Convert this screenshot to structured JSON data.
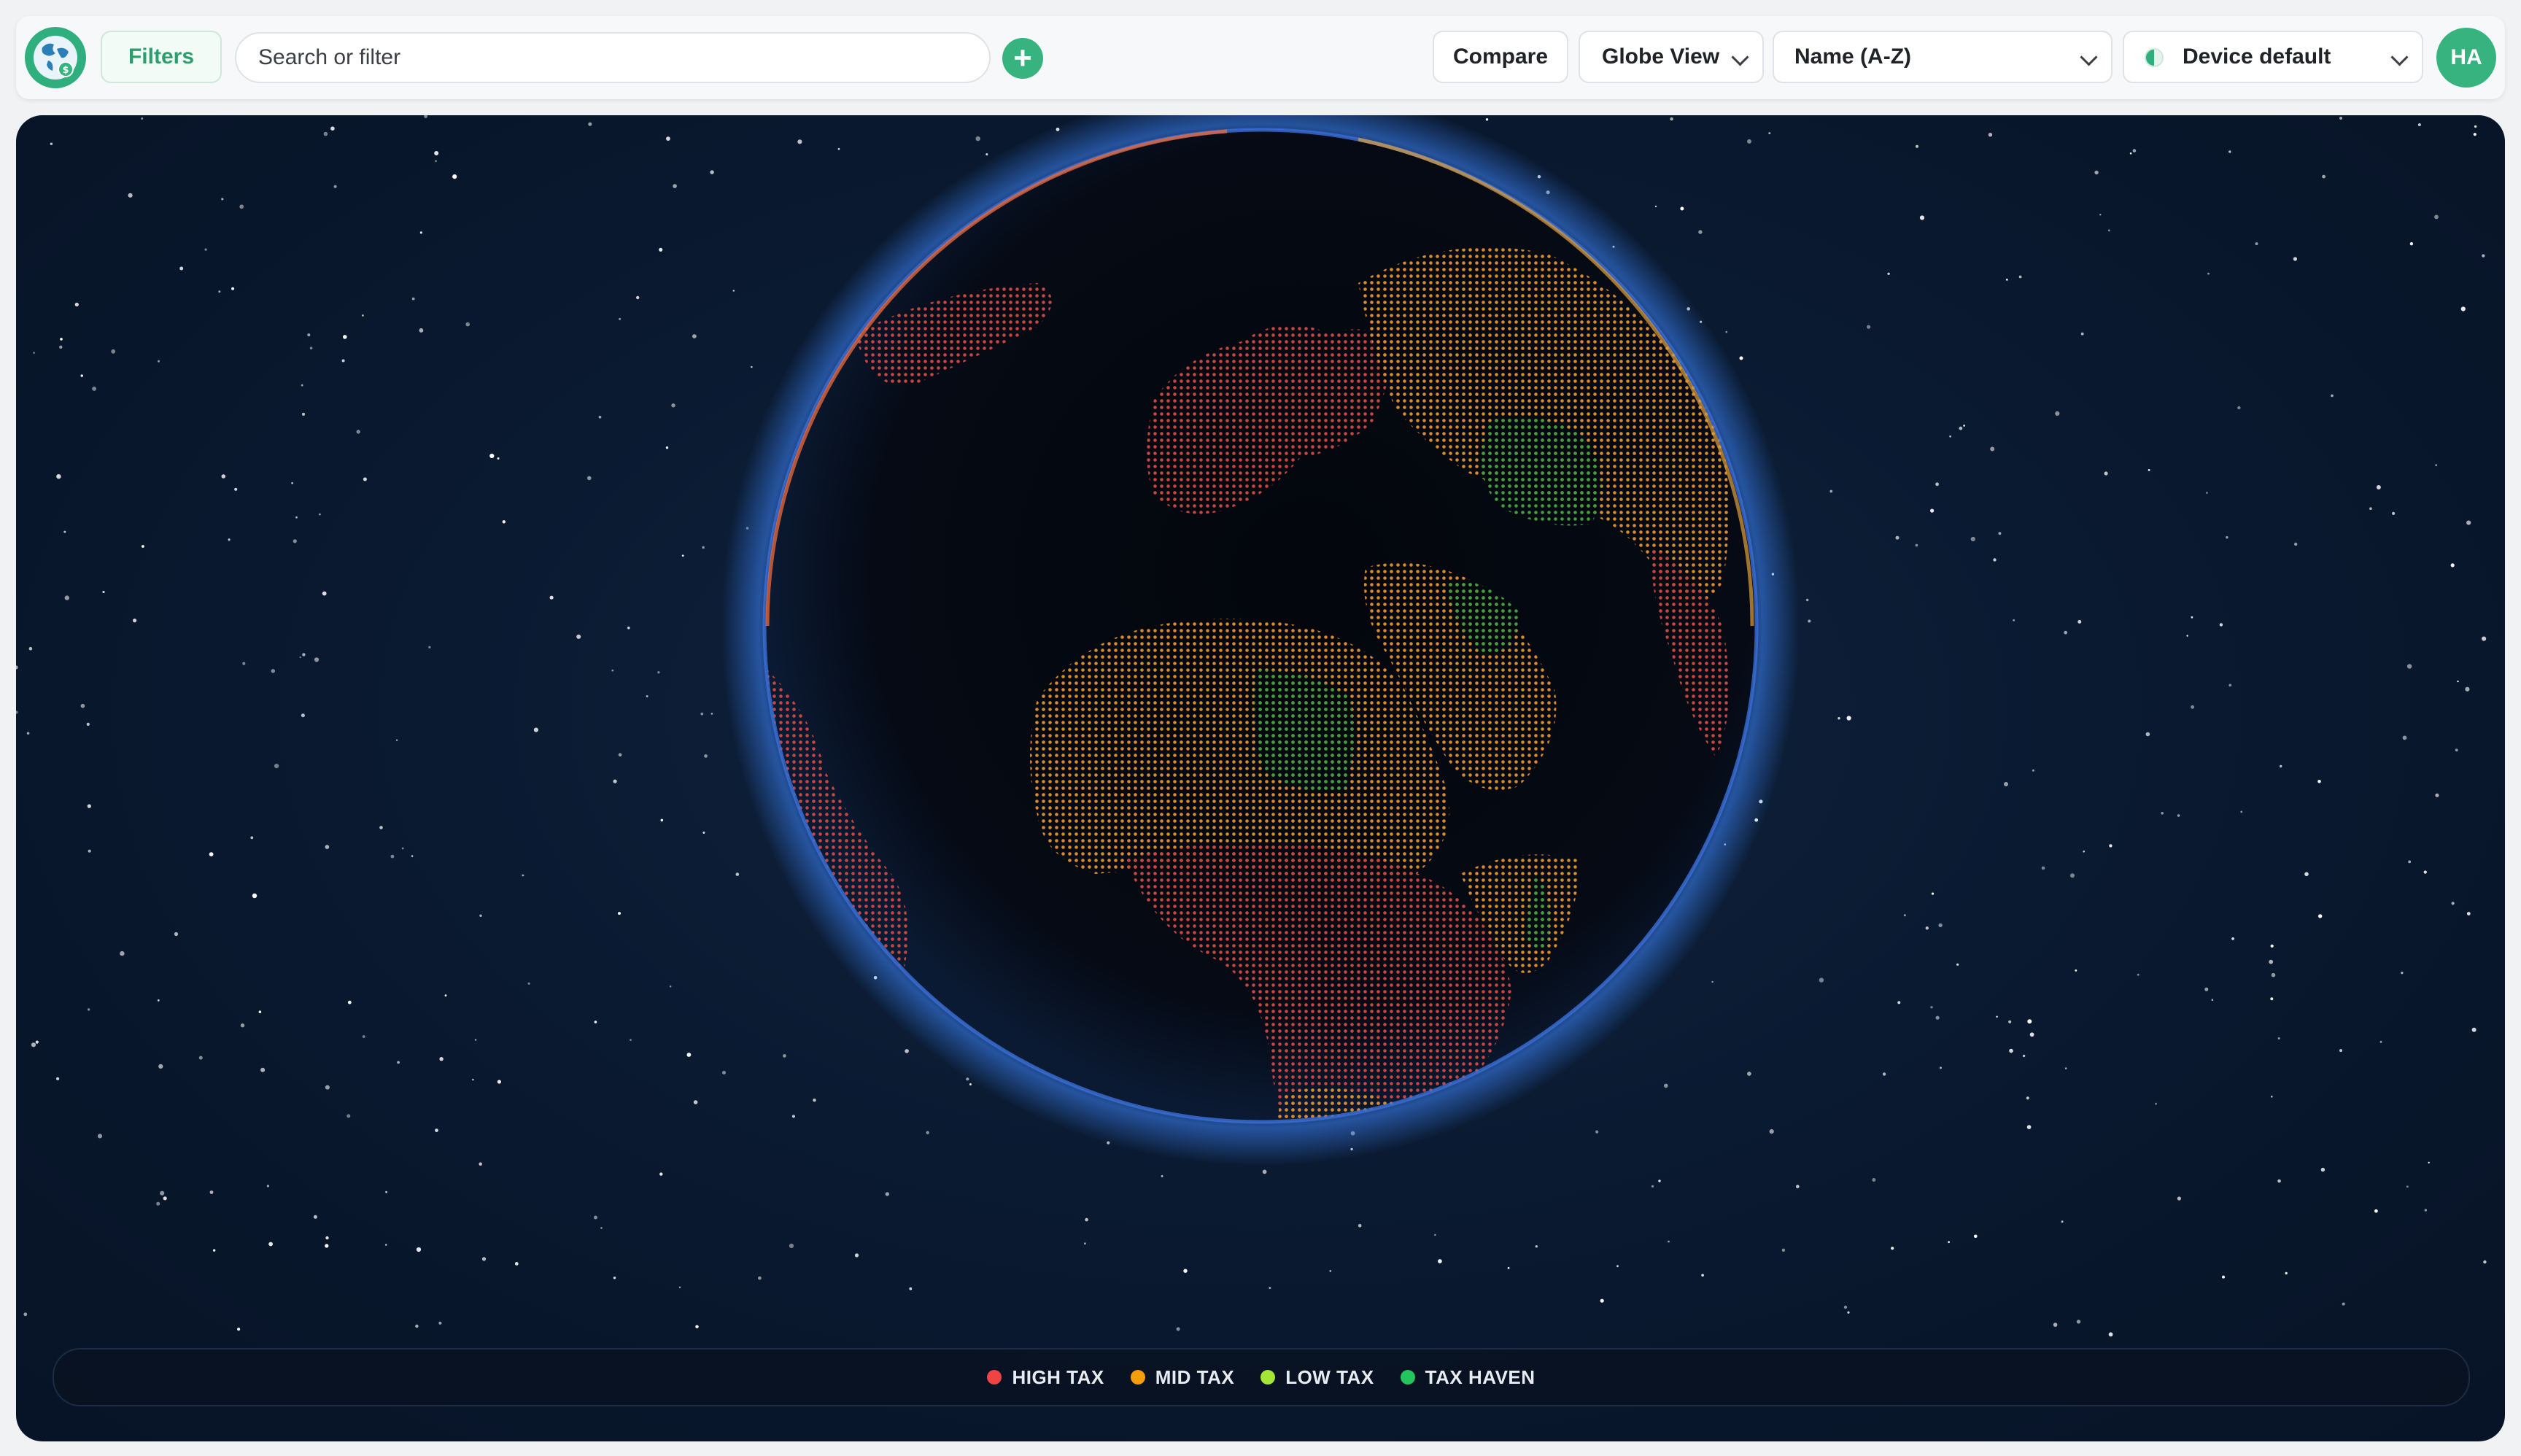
{
  "toolbar": {
    "filters_label": "Filters",
    "search_placeholder": "Search or filter",
    "add_symbol": "+",
    "compare_label": "Compare",
    "view_label": "Globe View",
    "sort_label": "Name (A-Z)",
    "theme_label": "Device default",
    "avatar_initials": "HA"
  },
  "icons": {
    "logo": "globe-logo-icon",
    "add": "plus-icon",
    "chevron": "chevron-down-icon",
    "theme": "half-circle-theme-icon"
  },
  "legend": {
    "items": [
      {
        "label": "HIGH TAX",
        "color": "#ef4444"
      },
      {
        "label": "MID TAX",
        "color": "#f59e0b"
      },
      {
        "label": "LOW TAX",
        "color": "#a3e635"
      },
      {
        "label": "TAX HAVEN",
        "color": "#22c55e"
      }
    ]
  },
  "colors": {
    "accent": "#36b37e",
    "space": "#0a1a31",
    "globe_glow": "#3b82f6"
  }
}
